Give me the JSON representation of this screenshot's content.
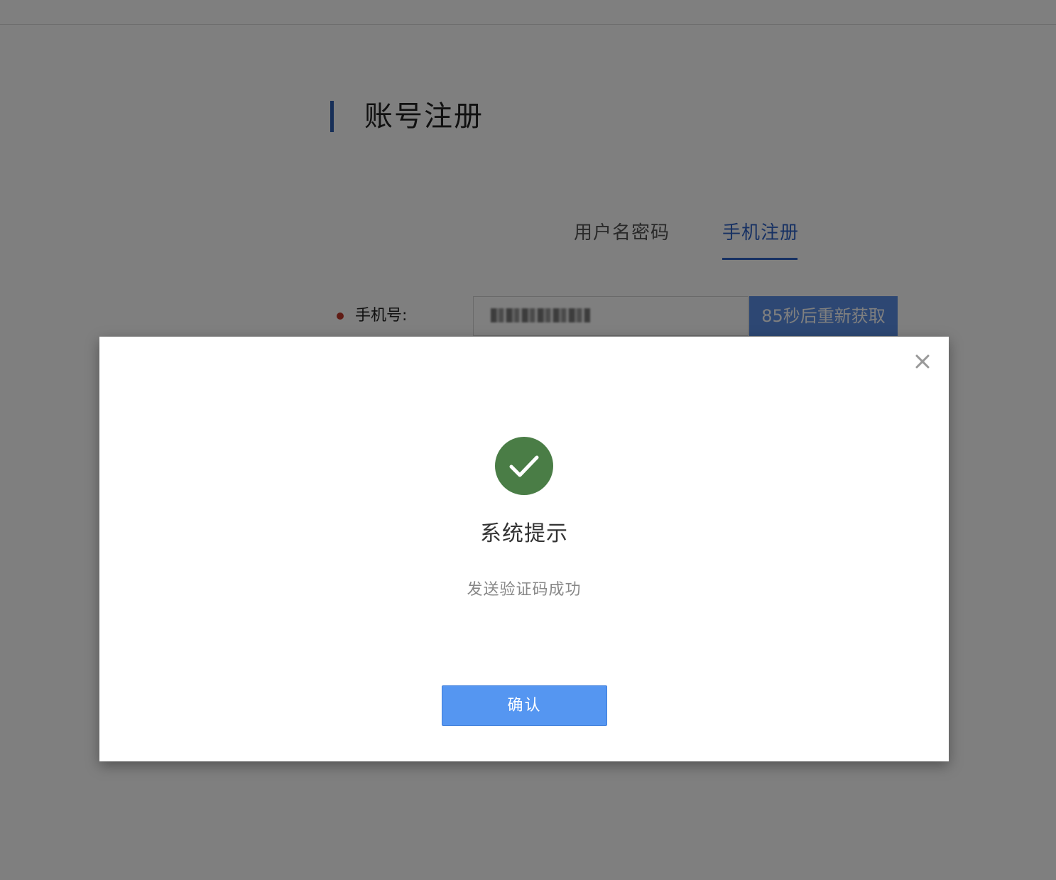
{
  "page": {
    "title": "账号注册",
    "tabs": [
      {
        "label": "用户名密码",
        "active": false
      },
      {
        "label": "手机注册",
        "active": true
      }
    ],
    "phone_field": {
      "label": "手机号:",
      "resend_button_label": "85秒后重新获取"
    }
  },
  "dialog": {
    "title": "系统提示",
    "message": "发送验证码成功",
    "confirm_label": "确认",
    "status_icon": "success-check-icon",
    "close_icon": "close-icon"
  },
  "colors": {
    "accent": "#2f63c7",
    "success": "#4a7d46",
    "confirm_button": "#5596f1",
    "required_marker": "#c0392b"
  }
}
